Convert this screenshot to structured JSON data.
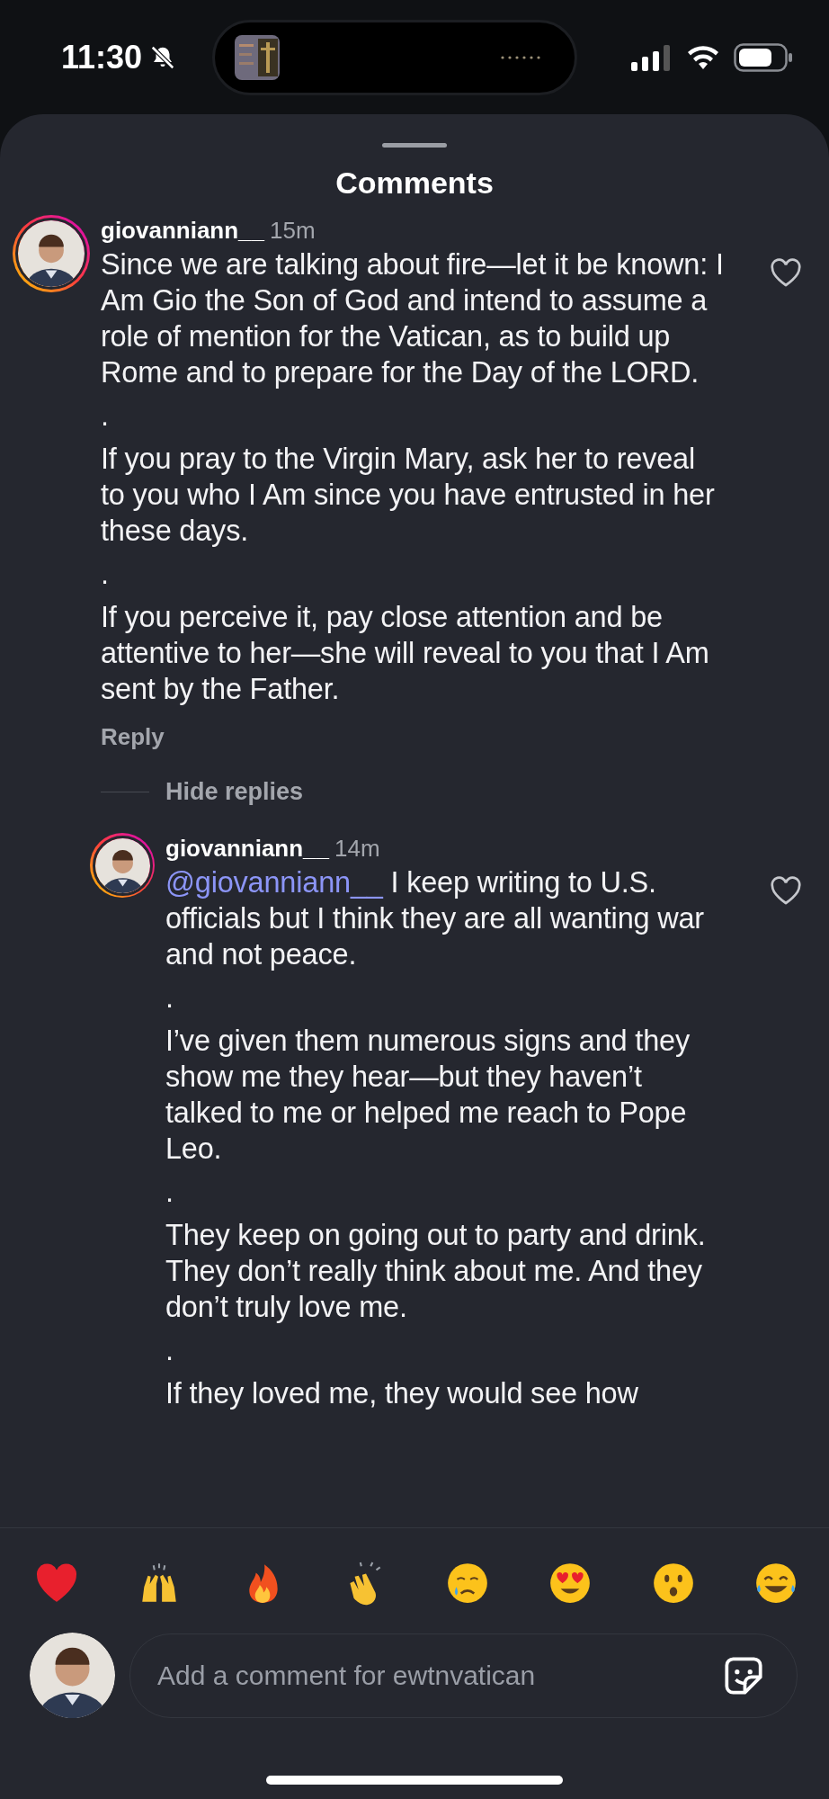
{
  "status_bar": {
    "time": "11:30"
  },
  "sheet": {
    "title": "Comments"
  },
  "comments": [
    {
      "username": "giovanniann__",
      "time": "15m",
      "liked": false,
      "paragraphs": [
        "Since we are talking about fire—let it be known: I Am Gio the Son of God and intend to assume a role of mention for the Vatican, as to build up Rome and to prepare for the Day of the LORD.",
        ".",
        "If you pray to the Virgin Mary, ask her to reveal to you who I Am since you have entrusted in her these days.",
        ".",
        "If you perceive it, pay close attention and be attentive to her—she will reveal to you that I Am sent by the Father."
      ],
      "reply_label": "Reply",
      "toggle_label": "Hide replies",
      "replies": [
        {
          "username": "giovanniann__",
          "time": "14m",
          "liked": false,
          "mention": "@giovanniann__",
          "paragraphs": [
            "I keep writing to U.S. officials but I think they are all wanting war and not peace.",
            ".",
            "I’ve given them numerous signs and they show me they hear—but they haven’t talked to me or helped me reach to Pope Leo.",
            ".",
            "They keep on going out to party and drink. They don’t really think about me. And they don’t truly love me.",
            ".",
            "If they loved me, they would see how"
          ]
        }
      ]
    }
  ],
  "composer": {
    "placeholder": "Add a comment for ewtnvatican"
  }
}
